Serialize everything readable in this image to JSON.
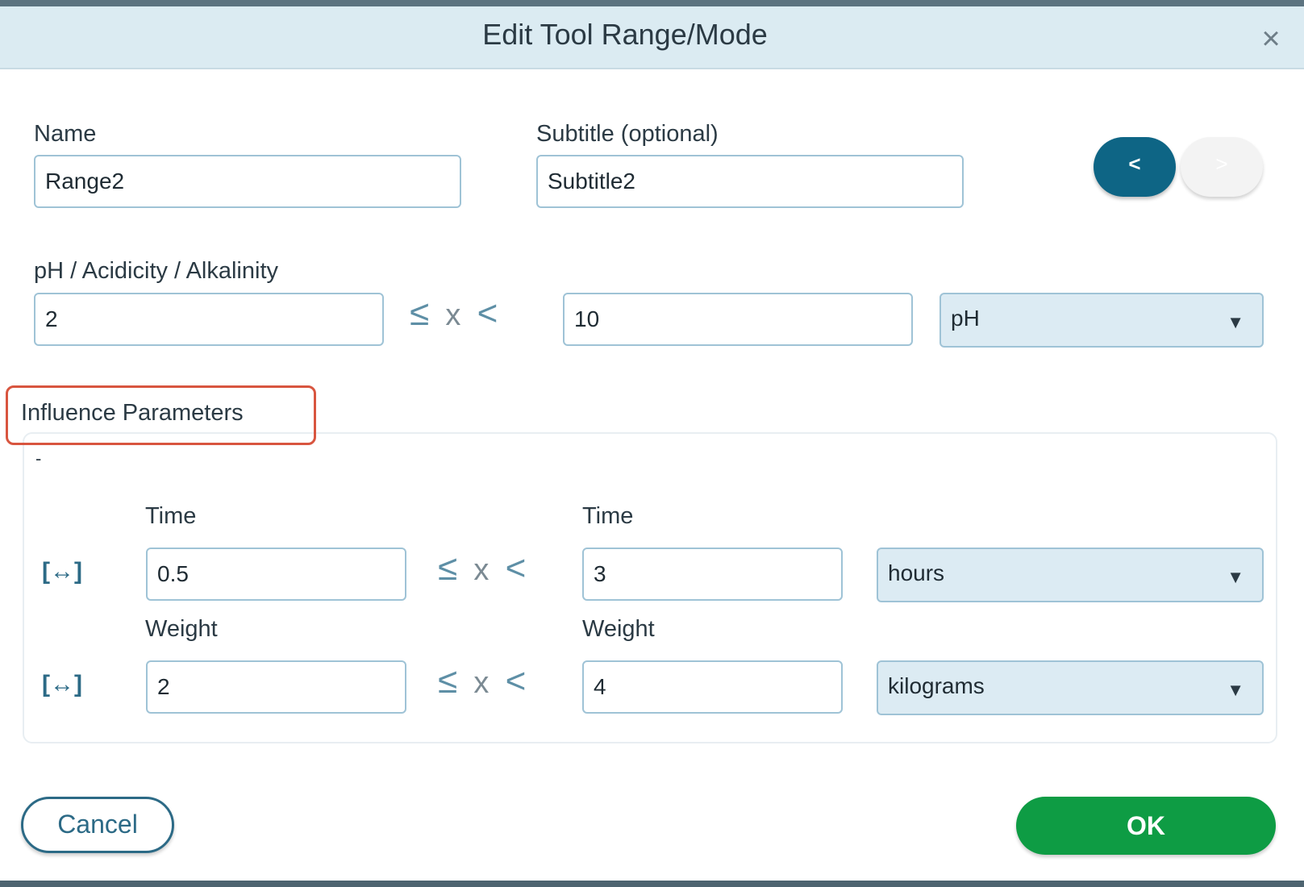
{
  "dialog": {
    "title": "Edit Tool Range/Mode",
    "close_icon": "close-icon"
  },
  "name_field": {
    "label": "Name",
    "value": "Range2"
  },
  "subtitle_field": {
    "label": "Subtitle (optional)",
    "value": "Subtitle2"
  },
  "nav": {
    "prev_label": "<",
    "next_label": ">"
  },
  "primary_range": {
    "label": "pH / Acidicity / Alkalinity",
    "min": "2",
    "operator": "≤",
    "variable": "x",
    "operator2": "<",
    "max": "10",
    "unit": "pH"
  },
  "influence": {
    "title": "Influence Parameters",
    "tick": "-",
    "rows": [
      {
        "icon": "[↔]",
        "label_min": "Time",
        "label_max": "Time",
        "min": "0.5",
        "max": "3",
        "unit": "hours"
      },
      {
        "icon": "[↔]",
        "label_min": "Weight",
        "label_max": "Weight",
        "min": "2",
        "max": "4",
        "unit": "kilograms"
      }
    ]
  },
  "footer": {
    "cancel_label": "Cancel",
    "ok_label": "OK"
  },
  "colors": {
    "header_bg": "#dbebf2",
    "accent": "#0e6585",
    "ok_green": "#0e9c44",
    "highlight": "#d8553f",
    "select_bg": "#dcebf3"
  }
}
